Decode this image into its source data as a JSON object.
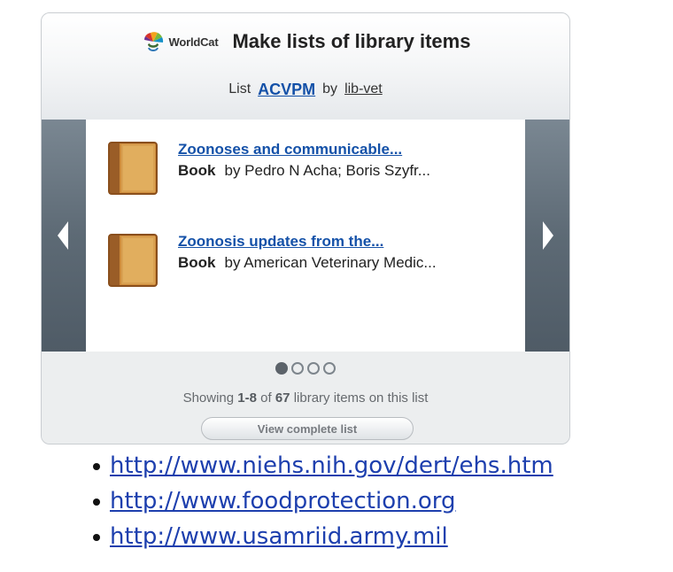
{
  "widget": {
    "brand": {
      "logo_text": "WorldCat",
      "title": "Make lists of library items"
    },
    "list_row": {
      "prefix": "List",
      "list_name": "ACVPM",
      "by": "by",
      "owner": "lib-vet"
    },
    "carousel": {
      "items": [
        {
          "title": "Zoonoses and communicable...",
          "type": "Book",
          "byline": "by Pedro N Acha; Boris Szyfr..."
        },
        {
          "title": "Zoonosis updates from the...",
          "type": "Book",
          "byline": "by American Veterinary Medic..."
        }
      ],
      "pagination": {
        "current_page": 1,
        "total_pages": 4
      }
    },
    "footer": {
      "showing_prefix": "Showing",
      "range": "1-8",
      "of": "of",
      "total": "67",
      "suffix": "library items on this list",
      "view_button": "View complete list"
    }
  },
  "links": [
    "http://www.niehs.nih.gov/dert/ehs.htm",
    "http://www.foodprotection.org",
    "http://www.usamriid.army.mil"
  ],
  "colors": {
    "link": "#1451a8",
    "page_link": "#1d3fae",
    "nav_arrow_bg": "#5d6a75",
    "book": "#b8762f"
  },
  "icons": {
    "logo": "worldcat-logo-icon",
    "prev": "chevron-left-icon",
    "next": "chevron-right-icon",
    "book": "book-icon"
  }
}
